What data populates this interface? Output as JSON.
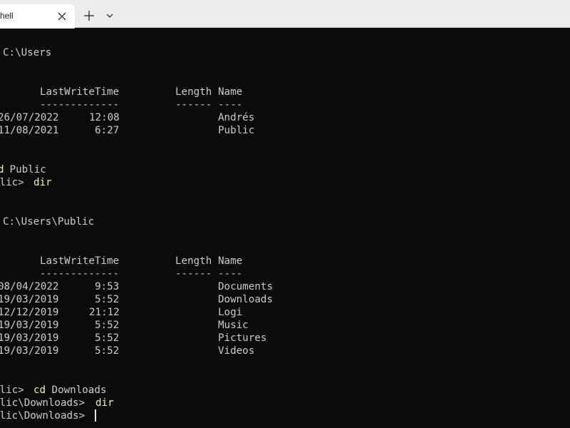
{
  "window": {
    "tab_title": "hell",
    "new_tab_symbol": "+",
    "icons": [
      "close-icon",
      "plus-icon",
      "chevron-down-icon"
    ]
  },
  "colors": {
    "terminal_bg": "#0c0c0c",
    "text": "#cccccc",
    "command": "#f9f1a5",
    "titlebar_bg": "#ececec",
    "tab_bg": "#ffffff"
  },
  "terminal": {
    "dir1_line": "C:\\Users",
    "dir1_headers": {
      "time": "LastWriteTime",
      "length": "Length",
      "name": "Name"
    },
    "dir1_separators": {
      "time": "-------------",
      "length": "------",
      "name": "----"
    },
    "dir1_rows": [
      {
        "date": "26/07/2022",
        "time": "12:08",
        "name": "Andrés"
      },
      {
        "date": "11/08/2021",
        "time": "6:27",
        "name": "Public"
      }
    ],
    "cd_public": {
      "prefix": "",
      "cmd_head": "d",
      "cmd_arg": " Public"
    },
    "dir_public_prompt": {
      "prompt": "blic> ",
      "command": "dir"
    },
    "dir2_line": "C:\\Users\\Public",
    "dir2_headers": {
      "time": "LastWriteTime",
      "length": "Length",
      "name": "Name"
    },
    "dir2_separators": {
      "time": "-------------",
      "length": "------",
      "name": "----"
    },
    "dir2_rows": [
      {
        "date": "08/04/2022",
        "time": "9:53",
        "name": "Documents"
      },
      {
        "date": "19/03/2019",
        "time": "5:52",
        "name": "Downloads"
      },
      {
        "date": "12/12/2019",
        "time": "21:12",
        "name": "Logi"
      },
      {
        "date": "19/03/2019",
        "time": "5:52",
        "name": "Music"
      },
      {
        "date": "19/03/2019",
        "time": "5:52",
        "name": "Pictures"
      },
      {
        "date": "19/03/2019",
        "time": "5:52",
        "name": "Videos"
      }
    ],
    "cd_downloads": {
      "prompt": "blic> ",
      "cmd_head": "cd",
      "cmd_arg": " Downloads"
    },
    "dir_downloads": {
      "prompt": "blic\\Downloads> ",
      "command": "dir"
    },
    "current_prompt": {
      "prompt": "blic\\Downloads> ",
      "input": ""
    }
  }
}
